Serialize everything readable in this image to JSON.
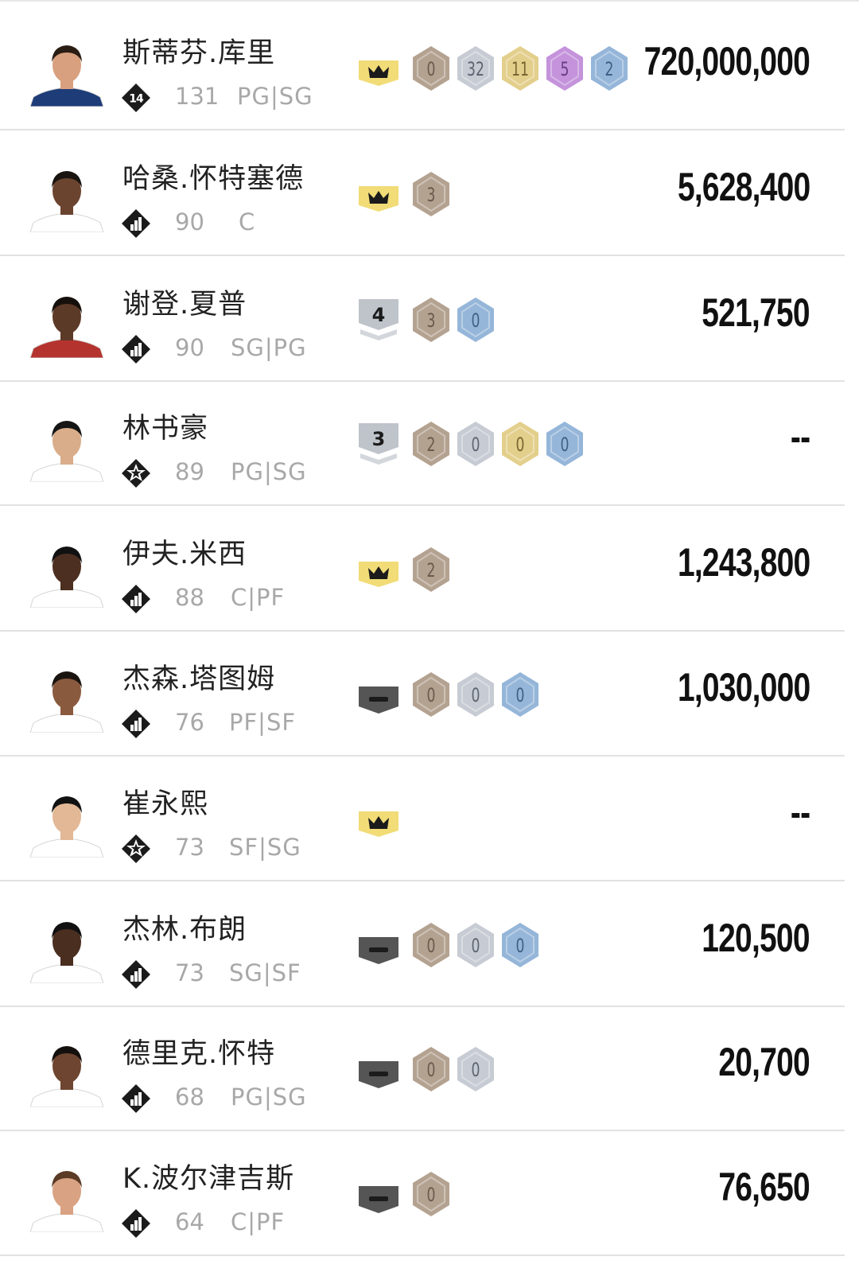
{
  "colors": {
    "bronze": "#b4a291",
    "silver": "#c7cbd3",
    "gold": "#e3cf8c",
    "amethyst": "#c493db",
    "diamond": "#95b6d9",
    "crown_yellow": "#f1dc77",
    "tier_silver": "#bfc4cb",
    "dash_gray": "#555555"
  },
  "players": [
    {
      "name": "斯蒂芬.库里",
      "level_icon": "level-14-icon",
      "level_text": "14",
      "ovr": "131",
      "position": "PG|SG",
      "evolution": {
        "type": "crown",
        "label": ""
      },
      "badges": [
        {
          "tier": "bronze",
          "count": "0"
        },
        {
          "tier": "silver",
          "count": "32"
        },
        {
          "tier": "gold",
          "count": "11"
        },
        {
          "tier": "amethyst",
          "count": "5"
        },
        {
          "tier": "diamond",
          "count": "2"
        }
      ],
      "price": "720,000,000"
    },
    {
      "name": "哈桑.怀特塞德",
      "level_icon": "bars-icon",
      "level_text": "",
      "ovr": "90",
      "position": "C",
      "evolution": {
        "type": "crown",
        "label": ""
      },
      "badges": [
        {
          "tier": "bronze",
          "count": "3"
        }
      ],
      "price": "5,628,400"
    },
    {
      "name": "谢登.夏普",
      "level_icon": "bars-icon",
      "level_text": "",
      "ovr": "90",
      "position": "SG|PG",
      "evolution": {
        "type": "tier",
        "label": "4"
      },
      "badges": [
        {
          "tier": "bronze",
          "count": "3"
        },
        {
          "tier": "diamond",
          "count": "0"
        }
      ],
      "price": "521,750"
    },
    {
      "name": "林书豪",
      "level_icon": "star-icon",
      "level_text": "",
      "ovr": "89",
      "position": "PG|SG",
      "evolution": {
        "type": "tier",
        "label": "3"
      },
      "badges": [
        {
          "tier": "bronze",
          "count": "2"
        },
        {
          "tier": "silver",
          "count": "0"
        },
        {
          "tier": "gold",
          "count": "0"
        },
        {
          "tier": "diamond",
          "count": "0"
        }
      ],
      "price": "--"
    },
    {
      "name": "伊夫.米西",
      "level_icon": "bars-icon",
      "level_text": "",
      "ovr": "88",
      "position": "C|PF",
      "evolution": {
        "type": "crown",
        "label": ""
      },
      "badges": [
        {
          "tier": "bronze",
          "count": "2"
        }
      ],
      "price": "1,243,800"
    },
    {
      "name": "杰森.塔图姆",
      "level_icon": "bars-icon",
      "level_text": "",
      "ovr": "76",
      "position": "PF|SF",
      "evolution": {
        "type": "dash",
        "label": ""
      },
      "badges": [
        {
          "tier": "bronze",
          "count": "0"
        },
        {
          "tier": "silver",
          "count": "0"
        },
        {
          "tier": "diamond",
          "count": "0"
        }
      ],
      "price": "1,030,000"
    },
    {
      "name": "崔永熙",
      "level_icon": "star-icon",
      "level_text": "",
      "ovr": "73",
      "position": "SF|SG",
      "evolution": {
        "type": "crown",
        "label": ""
      },
      "badges": [],
      "price": "--"
    },
    {
      "name": "杰林.布朗",
      "level_icon": "bars-icon",
      "level_text": "",
      "ovr": "73",
      "position": "SG|SF",
      "evolution": {
        "type": "dash",
        "label": ""
      },
      "badges": [
        {
          "tier": "bronze",
          "count": "0"
        },
        {
          "tier": "silver",
          "count": "0"
        },
        {
          "tier": "diamond",
          "count": "0"
        }
      ],
      "price": "120,500"
    },
    {
      "name": "德里克.怀特",
      "level_icon": "bars-icon",
      "level_text": "",
      "ovr": "68",
      "position": "PG|SG",
      "evolution": {
        "type": "dash",
        "label": ""
      },
      "badges": [
        {
          "tier": "bronze",
          "count": "0"
        },
        {
          "tier": "silver",
          "count": "0"
        }
      ],
      "price": "20,700"
    },
    {
      "name": "K.波尔津吉斯",
      "level_icon": "bars-icon",
      "level_text": "",
      "ovr": "64",
      "position": "C|PF",
      "evolution": {
        "type": "dash",
        "label": ""
      },
      "badges": [
        {
          "tier": "bronze",
          "count": "0"
        }
      ],
      "price": "76,650"
    }
  ]
}
